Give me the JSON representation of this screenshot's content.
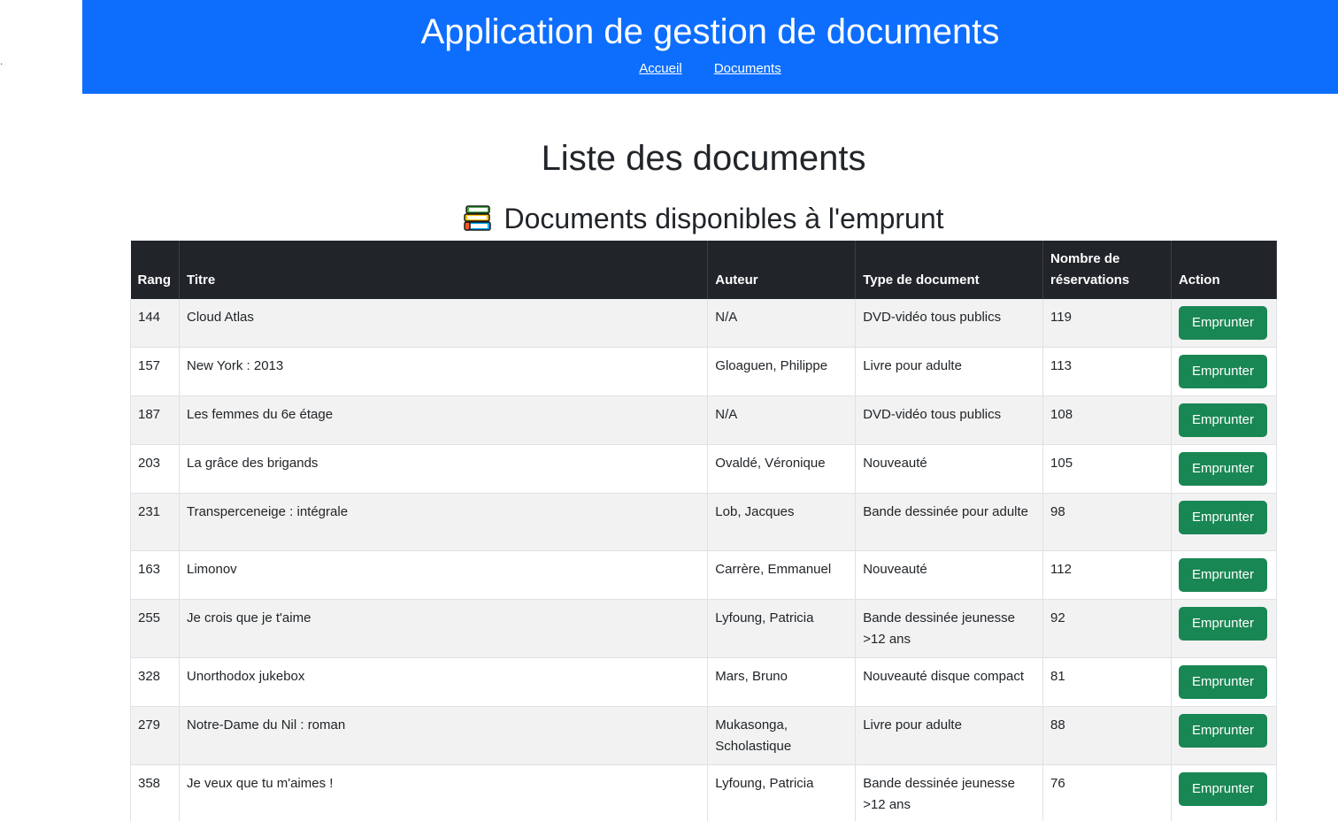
{
  "header": {
    "title": "Application de gestion de documents",
    "nav": [
      {
        "label": "Accueil"
      },
      {
        "label": "Documents"
      }
    ]
  },
  "stray_text": ".",
  "page_title": "Liste des documents",
  "section": {
    "icon": "books-icon",
    "title": "Documents disponibles à l'emprunt"
  },
  "table": {
    "headers": {
      "rang": "Rang",
      "titre": "Titre",
      "auteur": "Auteur",
      "type": "Type de document",
      "nb": "Nombre de réservations",
      "action": "Action"
    },
    "rows": [
      {
        "rang": "144",
        "titre": "Cloud Atlas",
        "auteur": "N/A",
        "type": "DVD-vidéo tous publics",
        "nb": "119",
        "action": "Emprunter"
      },
      {
        "rang": "157",
        "titre": "New York : 2013",
        "auteur": "Gloaguen, Philippe",
        "type": "Livre pour adulte",
        "nb": "113",
        "action": "Emprunter"
      },
      {
        "rang": "187",
        "titre": "Les femmes du 6e étage",
        "auteur": "N/A",
        "type": "DVD-vidéo tous publics",
        "nb": "108",
        "action": "Emprunter"
      },
      {
        "rang": "203",
        "titre": "La grâce des brigands",
        "auteur": "Ovaldé, Véronique",
        "type": "Nouveauté",
        "nb": "105",
        "action": "Emprunter"
      },
      {
        "rang": "231",
        "titre": "Transperceneige : intégrale",
        "auteur": "Lob, Jacques",
        "type": "Bande dessinée pour adulte",
        "nb": "98",
        "action": "Emprunter"
      },
      {
        "rang": "163",
        "titre": "Limonov",
        "auteur": "Carrère, Emmanuel",
        "type": "Nouveauté",
        "nb": "112",
        "action": "Emprunter"
      },
      {
        "rang": "255",
        "titre": "Je crois que je t'aime",
        "auteur": "Lyfoung, Patricia",
        "type": "Bande dessinée jeunesse >12 ans",
        "nb": "92",
        "action": "Emprunter"
      },
      {
        "rang": "328",
        "titre": "Unorthodox jukebox",
        "auteur": "Mars, Bruno",
        "type": "Nouveauté disque compact",
        "nb": "81",
        "action": "Emprunter"
      },
      {
        "rang": "279",
        "titre": "Notre-Dame du Nil : roman",
        "auteur": "Mukasonga, Scholastique",
        "type": "Livre pour adulte",
        "nb": "88",
        "action": "Emprunter"
      },
      {
        "rang": "358",
        "titre": "Je veux que tu m'aimes !",
        "auteur": "Lyfoung, Patricia",
        "type": "Bande dessinée jeunesse >12 ans",
        "nb": "76",
        "action": "Emprunter"
      }
    ]
  },
  "colors": {
    "header_bg": "#0d6efd",
    "table_head_bg": "#212529",
    "button_bg": "#198754"
  }
}
